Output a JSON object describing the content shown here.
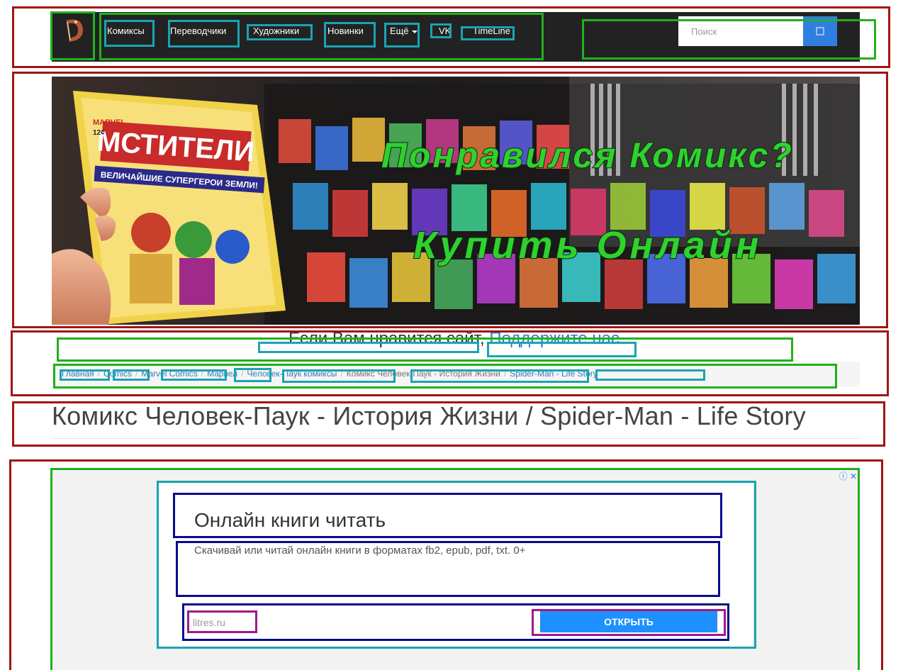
{
  "navbar": {
    "logo_icon": "site-logo-d",
    "items": [
      {
        "label": "Комиксы"
      },
      {
        "label": "Переводчики"
      },
      {
        "label": "Художники"
      },
      {
        "label": "Новинки"
      },
      {
        "label": "Ещё"
      },
      {
        "label": "VK"
      },
      {
        "label": "TimeLine"
      }
    ],
    "search": {
      "placeholder": "Поиск",
      "button_icon": "search-icon"
    }
  },
  "banner": {
    "line1": "Понравился Комикс?",
    "line2": "Купить Онлайн",
    "comic_cover_title": "МСТИТЕЛИ",
    "comic_cover_subtitle": "ВЕЛИЧАЙШИЕ СУПЕРГЕРОИ ЗЕМЛИ!",
    "comic_cover_brand": "MARVEL",
    "comic_cover_price": "12¢"
  },
  "support": {
    "text": "Если Вам нравится сайт,",
    "link": "Поддержите нас"
  },
  "breadcrumb": [
    {
      "label": "Главная"
    },
    {
      "label": "Comics"
    },
    {
      "label": "Marvel Comics"
    },
    {
      "label": "Марвел"
    },
    {
      "label": "Человек-Паук комиксы"
    },
    {
      "label": "Комикс Человек-Паук - История Жизни"
    },
    {
      "label": "Spider-Man - Life Story"
    }
  ],
  "title": "Комикс Человек-Паук - История Жизни / Spider-Man - Life Story",
  "ad": {
    "headline": "Онлайн книги читать",
    "description": "Скачивай или читай онлайн книги в форматах fb2, epub, pdf, txt. 0+",
    "url": "litres.ru",
    "cta": "ОТКРЫТЬ",
    "info_icon": "info-icon",
    "close_icon": "close-icon"
  },
  "colors": {
    "navbar_bg": "#222222",
    "accent_blue": "#2f7fe0",
    "link_blue": "#337ab7",
    "cta_blue": "#1e90ff",
    "annotation_red": "#a01515",
    "annotation_green": "#22b01c",
    "annotation_cyan": "#1aa3b3",
    "annotation_navy": "#0a0a8c",
    "annotation_purple": "#a0198c"
  }
}
